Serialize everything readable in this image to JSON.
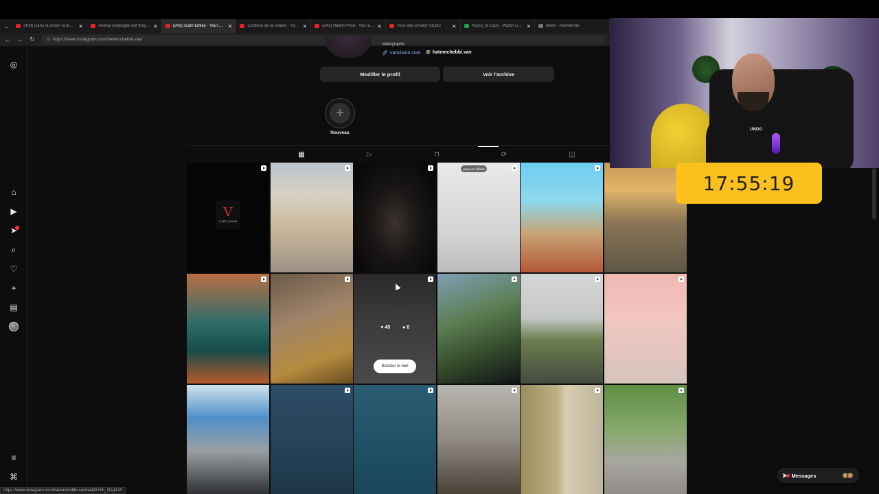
{
  "browser": {
    "tabs": [
      {
        "title": "(409) Dans la prison la plus sus...",
        "icon": "youtube-icon",
        "active": false
      },
      {
        "title": "Animal rampages but they get i...",
        "icon": "youtube-icon",
        "active": false
      },
      {
        "title": "(241) scam turkey - YouTube",
        "icon": "youtube-icon",
        "active": true
      },
      {
        "title": "Contenu de la chaîne - YouTub...",
        "icon": "youtube-icon",
        "active": false
      },
      {
        "title": "(241) Hatem Prod - YouTube",
        "icon": "youtube-icon",
        "active": false
      },
      {
        "title": "YouTube Creator Studio",
        "icon": "youtube-icon",
        "active": false
      },
      {
        "title": "Psyco_M Clips - Watch Live on I...",
        "icon": "kick-icon",
        "active": false
      },
      {
        "title": "tiktok - Recherche",
        "icon": "search-icon",
        "active": false
      }
    ],
    "url": "https://www.instagram.com/hatemchebbi.vav/",
    "status_url": "https://www.instagram.com/hatemchebbi.vav/reel/DYAh_O1ptU2/"
  },
  "profile": {
    "bio_line": "vidéographe",
    "link_website": "vartvision.com",
    "link_threads": "hatemchebbi.vav",
    "edit_button": "Modifier le profil",
    "archive_button": "Voir l'archive",
    "highlight_new_label": "Nouveau"
  },
  "profile_tabs": [
    "posts-grid",
    "reels",
    "saved",
    "reposts",
    "tagged"
  ],
  "grid": {
    "logo_card": {
      "mark": "V",
      "text": "V ART VISION"
    },
    "tag_label": "psyco.m.official",
    "hover_likes": "45",
    "hover_comments": "6",
    "boost_label": "Booster le reel"
  },
  "sidebar": {
    "notification_badge": "2"
  },
  "messages_label": "Messages",
  "timer": "17:55:19",
  "webcam_shirt_logo": "UNDG"
}
